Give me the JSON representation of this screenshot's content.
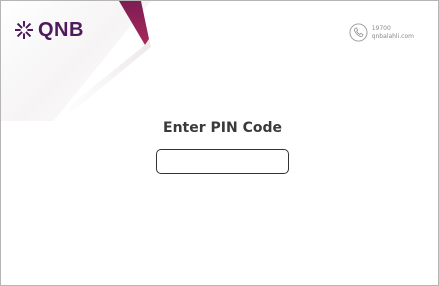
{
  "brand": {
    "name": "QNB",
    "logo_icon": "qnb-star-icon",
    "color": "#4e1a5c",
    "accent_color": "#9b1b4e"
  },
  "contact": {
    "icon": "phone-icon",
    "number": "19700",
    "website": "qnbalahli.com"
  },
  "pin_prompt": {
    "title": "Enter PIN Code",
    "value": "",
    "placeholder": ""
  }
}
